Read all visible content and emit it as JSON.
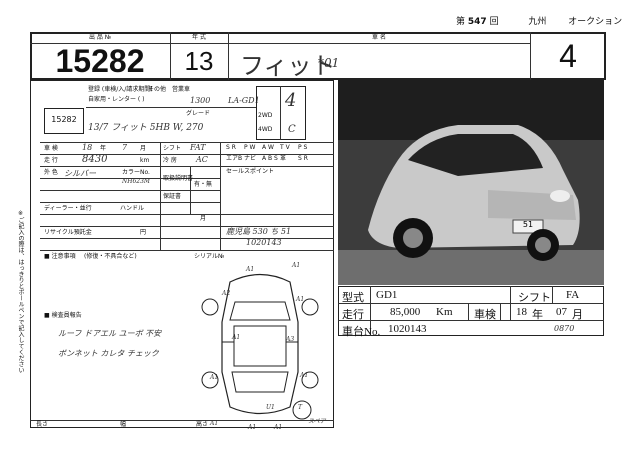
{
  "header": {
    "prefix": "第",
    "session": "547",
    "suffix": "回",
    "region": "九州",
    "auction": "オークション"
  },
  "top": {
    "lot_label": "出 品 №",
    "lot_number": "15282",
    "year_label": "年 式",
    "year": "13",
    "name_label": "車 名",
    "name": "フィット",
    "name_note": "*01",
    "grade_score": "4"
  },
  "left_sheet": {
    "lot_number": "15282",
    "usage_labels": [
      "自家用・レンター ( )",
      "その他",
      "営業車",
      "登録 (車検/入/請求期間)"
    ],
    "displacement": "1300",
    "model_code": "LA-GD1",
    "grade_label": "グレード",
    "grade_hand": "13/7 フィット 5HB W, 270",
    "drive_2wd": "2WD",
    "drive_4wd": "4WD",
    "score_hand": "4",
    "interior_hand": "C",
    "inspect_label": "車 検",
    "inspect_year": "18",
    "inspect_year_unit": "年",
    "inspect_month": "7",
    "inspect_month_unit": "月",
    "shift_label": "シフト",
    "shift_value": "FAT",
    "mileage_label": "走 行",
    "mileage_hand": "8430",
    "mileage_unit": "km",
    "ac_label": "冷 房",
    "ac_value": "AC",
    "color_label": "外 色",
    "color_hand": "シルバー",
    "color_code_label": "カラーNo.",
    "color_code": "NH623M",
    "manual_label": "取扱説明書",
    "manual_value": "有・無",
    "recycle_label": "リサイクル預託金",
    "recycle_value": "円",
    "dealer_label": "ディーラー・並行",
    "handle_label": "ハンドル",
    "month_label": "月",
    "warranty_label": "保証書",
    "plate_label": "シリアル№",
    "plate_hand": "鹿児島 530 ち 51",
    "serial_hand": "1020143",
    "features_label": "セールスポイント",
    "equipment": [
      "S R",
      "P W",
      "A W",
      "T V",
      "P S",
      "エアB",
      "ナビ",
      "A B S",
      "革",
      "S R"
    ],
    "notice_label": "■ 注意事項",
    "notice_sub": "(修復・不具合など)",
    "inspector_label": "■ 検査員報告",
    "inspector_notes": [
      "ルーフ ドアエル ユーボ 不安",
      "ボンネット カレタ チェック"
    ],
    "margin_note": "※ご記入の際は、はっきりとボールペンで記入してください",
    "diagram_marks": [
      "A1",
      "A1",
      "A2",
      "A1",
      "A1",
      "A3",
      "A1",
      "A1",
      "U1",
      "A1",
      "A1",
      "A1",
      "T",
      "スペア"
    ],
    "footer_labels": [
      "長さ",
      "幅",
      "高さ"
    ]
  },
  "photo": {
    "plate": "51"
  },
  "info": {
    "type_label": "型式",
    "type_value": "GD1",
    "shift_label": "シフト",
    "shift_value": "FA",
    "mileage_label": "走行",
    "mileage_value": "85,000",
    "mileage_unit": "Km",
    "inspect_label": "車検",
    "inspect_year": "18",
    "inspect_year_unit": "年",
    "inspect_month": "07",
    "inspect_month_unit": "月",
    "serial_label": "車台No.",
    "serial_value": "1020143",
    "serial_suffix": "0870"
  }
}
